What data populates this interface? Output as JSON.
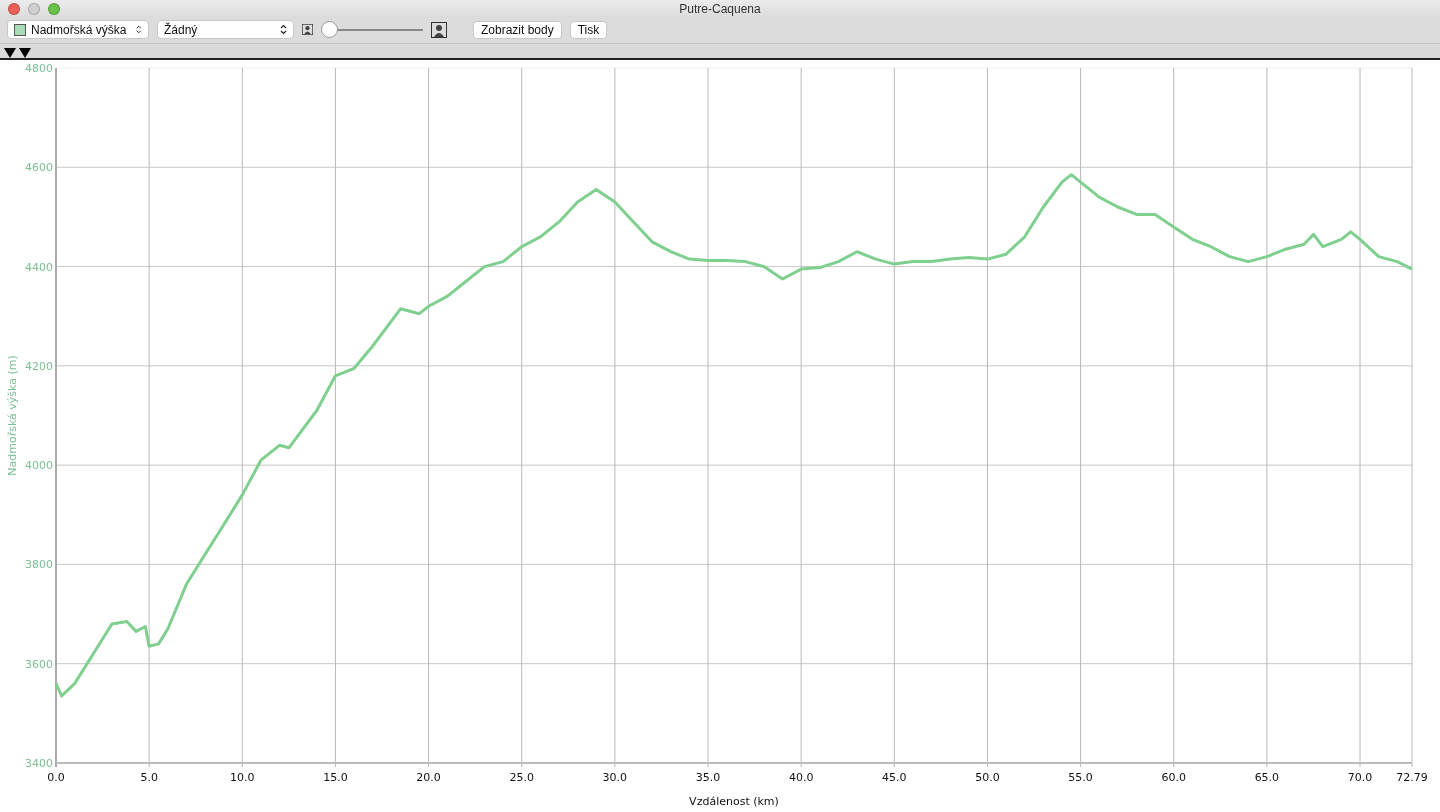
{
  "window": {
    "title": "Putre-Caquena"
  },
  "toolbar": {
    "series_popup": {
      "label": "Nadmořská výška",
      "color": "#a8dcb4"
    },
    "compare_popup": {
      "label": "Žádný"
    },
    "zoom_slider": {
      "level": 0
    },
    "buttons": [
      "Zobrazit body",
      "Tisk"
    ]
  },
  "chart": {
    "chart_data": {
      "type": "line",
      "grid": true,
      "xlabel": "Vzdálenost (km)",
      "ylabel": "Nadmořská výška (m)",
      "xlim": [
        0,
        72.79
      ],
      "ylim": [
        3400,
        4800
      ],
      "xticks": [
        {
          "value": 0,
          "label": "0.0"
        },
        {
          "value": 5,
          "label": "5.0"
        },
        {
          "value": 10,
          "label": "10.0"
        },
        {
          "value": 15,
          "label": "15.0"
        },
        {
          "value": 20,
          "label": "20.0"
        },
        {
          "value": 25,
          "label": "25.0"
        },
        {
          "value": 30,
          "label": "30.0"
        },
        {
          "value": 35,
          "label": "35.0"
        },
        {
          "value": 40,
          "label": "40.0"
        },
        {
          "value": 45,
          "label": "45.0"
        },
        {
          "value": 50,
          "label": "50.0"
        },
        {
          "value": 55,
          "label": "55.0"
        },
        {
          "value": 60,
          "label": "60.0"
        },
        {
          "value": 65,
          "label": "65.0"
        },
        {
          "value": 70,
          "label": "70.0"
        },
        {
          "value": 72.79,
          "label": "72.79"
        }
      ],
      "yticks": [
        3400,
        3600,
        3800,
        4000,
        4200,
        4400,
        4600,
        4800
      ],
      "x": [
        0,
        0.3,
        1,
        2,
        3,
        3.8,
        4.3,
        4.8,
        5,
        5.5,
        6,
        7,
        8,
        9,
        10,
        11,
        12,
        12.5,
        13,
        14,
        15,
        16,
        17,
        18,
        18.5,
        19.5,
        20,
        21,
        22,
        23,
        24,
        25,
        26,
        27,
        28,
        29,
        30,
        31,
        32,
        33,
        34,
        35,
        36,
        37,
        38,
        39,
        40,
        41,
        42,
        43,
        44,
        45,
        46,
        47,
        48,
        49,
        50,
        51,
        52,
        53,
        54,
        54.5,
        55,
        56,
        57,
        58,
        59,
        60,
        61,
        62,
        63,
        64,
        65,
        66,
        67,
        67.5,
        68,
        69,
        69.5,
        70,
        71,
        72,
        72.79
      ],
      "series": [
        {
          "color": "#7fcf8f",
          "values": [
            3560,
            3535,
            3560,
            3620,
            3680,
            3685,
            3665,
            3675,
            3635,
            3640,
            3670,
            3760,
            3820,
            3880,
            3940,
            4010,
            4040,
            4035,
            4060,
            4110,
            4180,
            4195,
            4240,
            4290,
            4315,
            4305,
            4320,
            4340,
            4370,
            4400,
            4410,
            4440,
            4460,
            4490,
            4530,
            4555,
            4530,
            4490,
            4450,
            4430,
            4415,
            4412,
            4412,
            4410,
            4400,
            4375,
            4395,
            4398,
            4410,
            4430,
            4415,
            4405,
            4410,
            4410,
            4415,
            4418,
            4415,
            4425,
            4460,
            4520,
            4570,
            4585,
            4570,
            4540,
            4520,
            4505,
            4505,
            4480,
            4455,
            4440,
            4420,
            4410,
            4420,
            4435,
            4445,
            4465,
            4440,
            4455,
            4470,
            4455,
            4420,
            4410,
            4395
          ]
        }
      ]
    }
  }
}
